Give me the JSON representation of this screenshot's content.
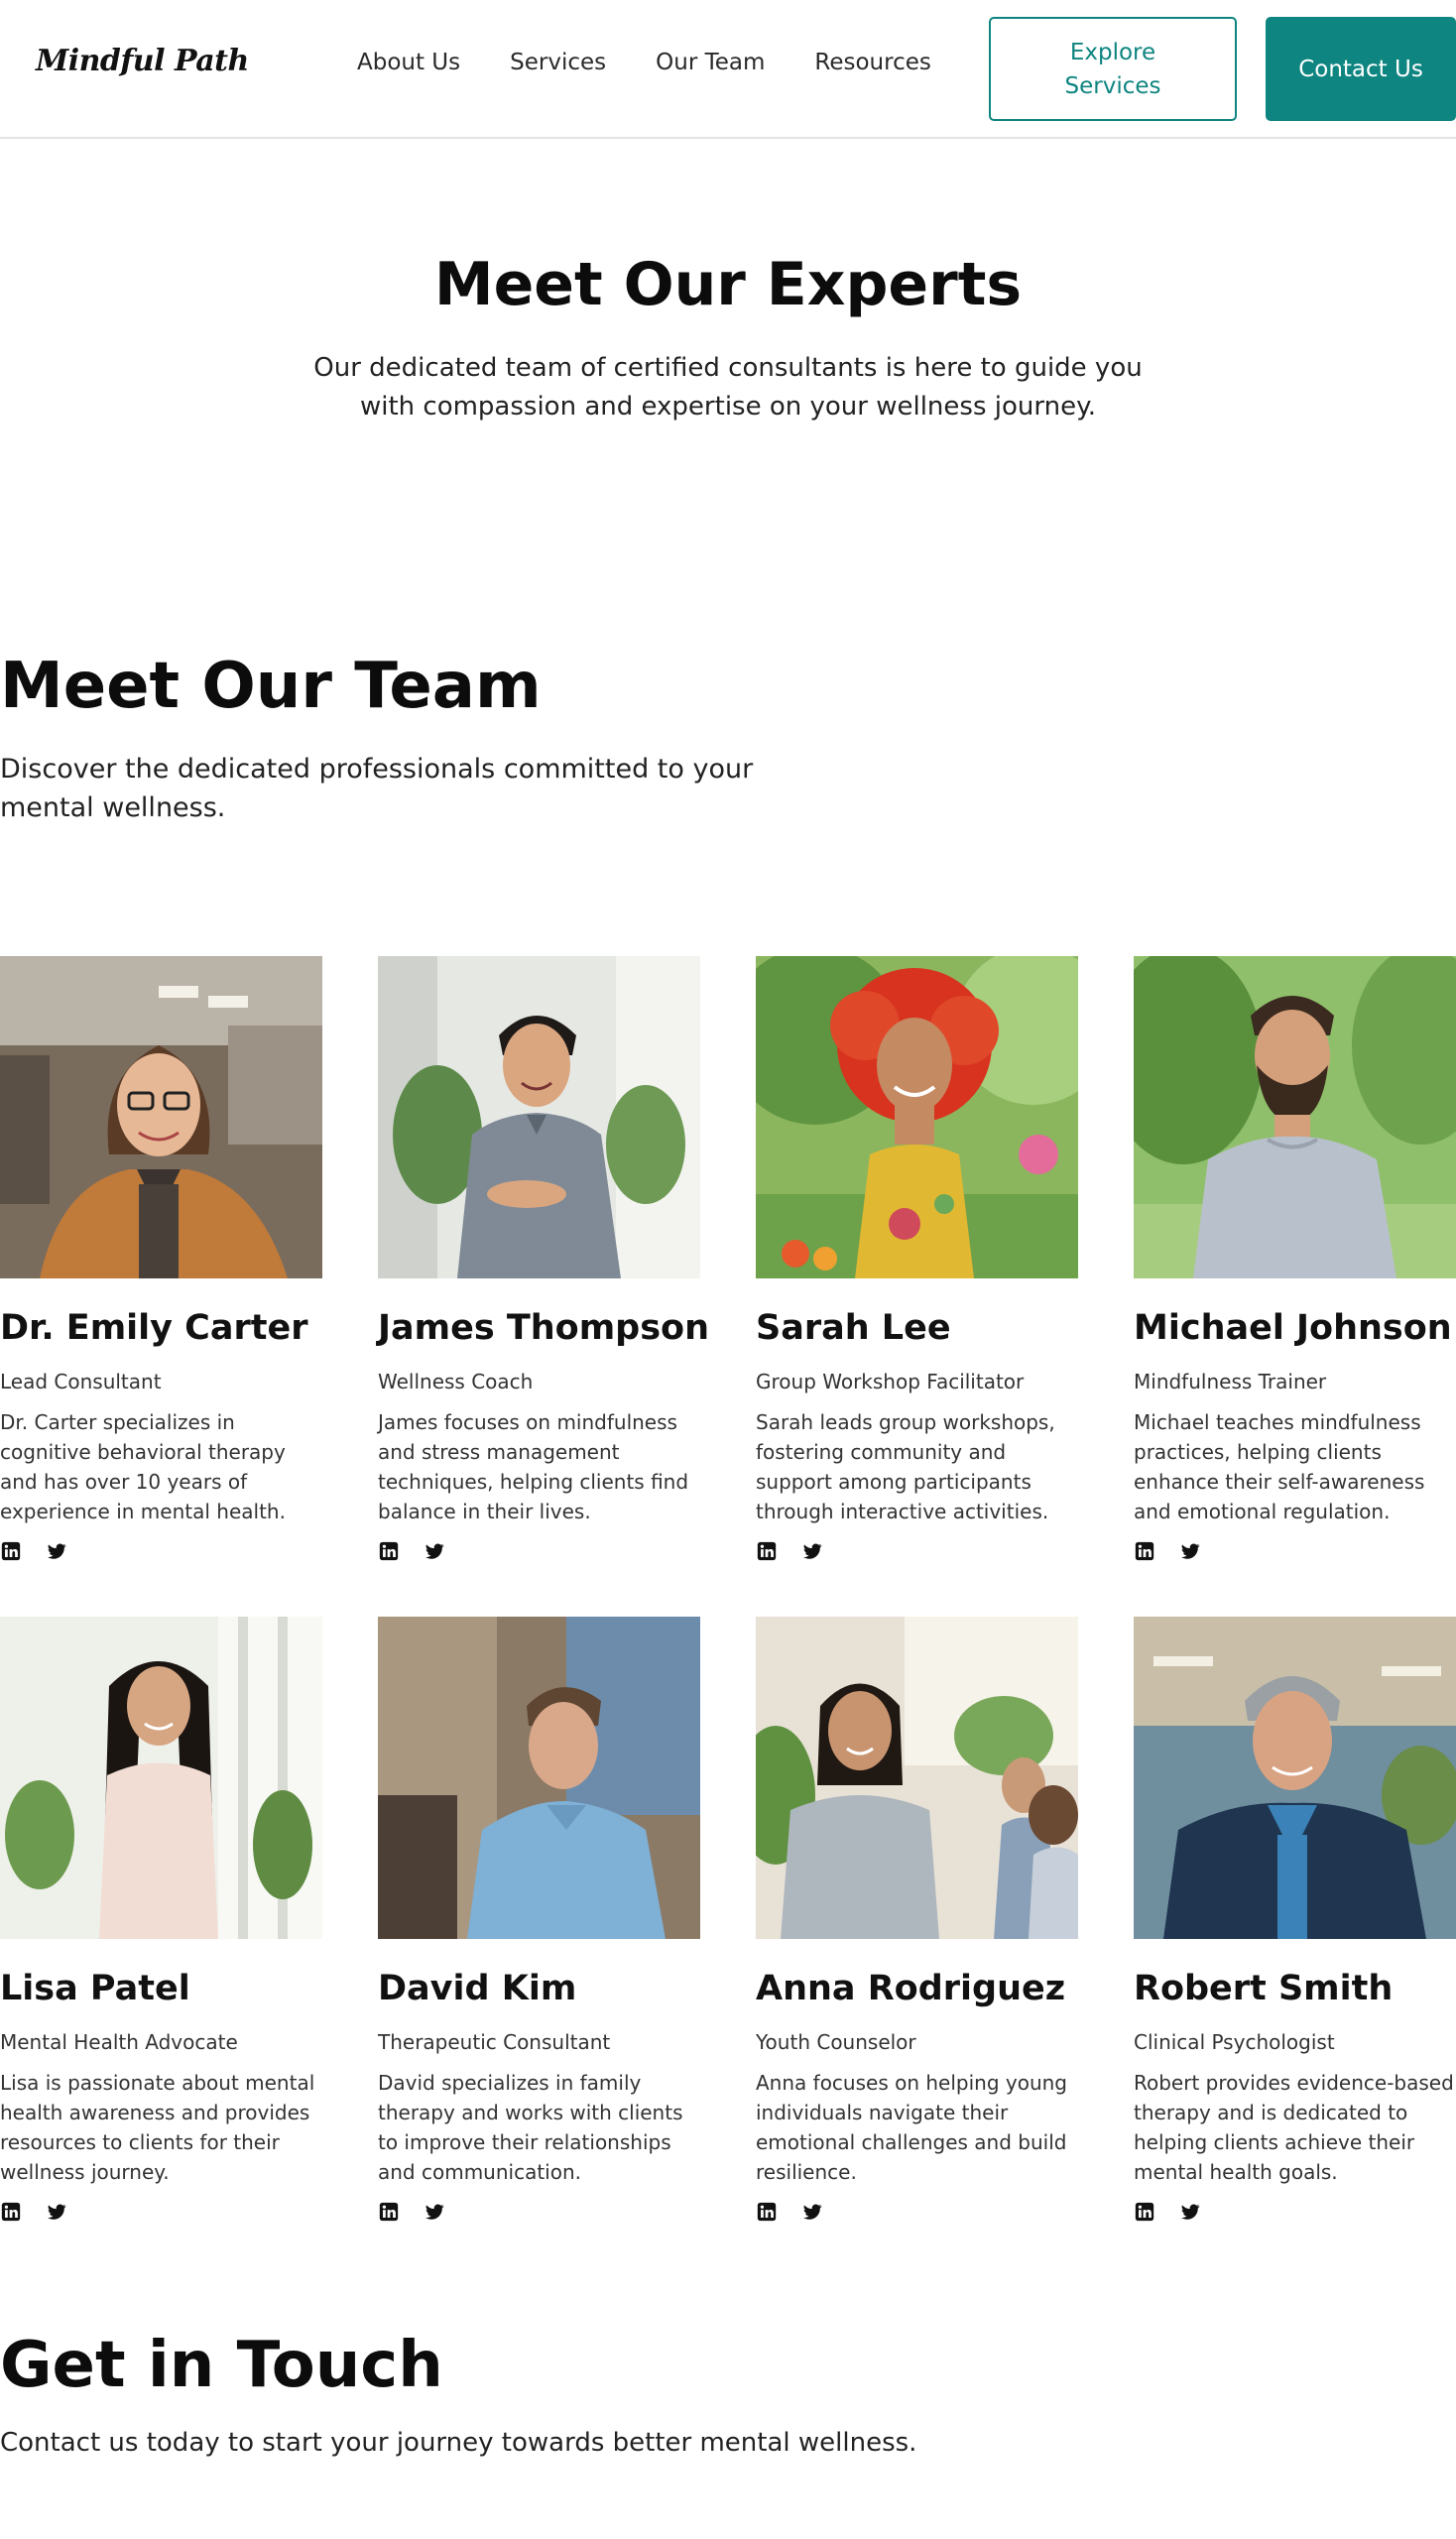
{
  "nav": {
    "logo": "Mindful Path",
    "links": [
      "About Us",
      "Services",
      "Our Team",
      "Resources"
    ],
    "explore_label": "Explore Services",
    "contact_label": "Contact Us"
  },
  "hero": {
    "title": "Meet Our Experts",
    "subtitle": "Our dedicated team of certified consultants is here to guide you with compassion and expertise on your wellness journey."
  },
  "team": {
    "title": "Meet Our Team",
    "subtitle": "Discover the dedicated professionals committed to your mental wellness.",
    "members": [
      {
        "name": "Dr. Emily Carter",
        "role": "Lead Consultant",
        "bio": "Dr. Carter specializes in cognitive behavioral therapy and has over 10 years of experience in mental health."
      },
      {
        "name": "James Thompson",
        "role": "Wellness Coach",
        "bio": "James focuses on mindfulness and stress management techniques, helping clients find balance in their lives."
      },
      {
        "name": "Sarah Lee",
        "role": "Group Workshop Facilitator",
        "bio": "Sarah leads group workshops, fostering community and support among participants through interactive activities."
      },
      {
        "name": "Michael Johnson",
        "role": "Mindfulness Trainer",
        "bio": "Michael teaches mindfulness practices, helping clients enhance their self-awareness and emotional regulation."
      },
      {
        "name": "Lisa Patel",
        "role": "Mental Health Advocate",
        "bio": "Lisa is passionate about mental health awareness and provides resources to clients for their wellness journey."
      },
      {
        "name": "David Kim",
        "role": "Therapeutic Consultant",
        "bio": "David specializes in family therapy and works with clients to improve their relationships and communication."
      },
      {
        "name": "Anna Rodriguez",
        "role": "Youth Counselor",
        "bio": "Anna focuses on helping young individuals navigate their emotional challenges and build resilience."
      },
      {
        "name": "Robert Smith",
        "role": "Clinical Psychologist",
        "bio": "Robert provides evidence-based therapy and is dedicated to helping clients achieve their mental health goals."
      }
    ]
  },
  "contact": {
    "title": "Get in Touch",
    "subtitle": "Contact us today to start your journey towards better mental wellness."
  },
  "icons": {
    "linkedin": "linkedin-icon",
    "twitter": "twitter-icon"
  },
  "colors": {
    "accent": "#0e8580"
  }
}
